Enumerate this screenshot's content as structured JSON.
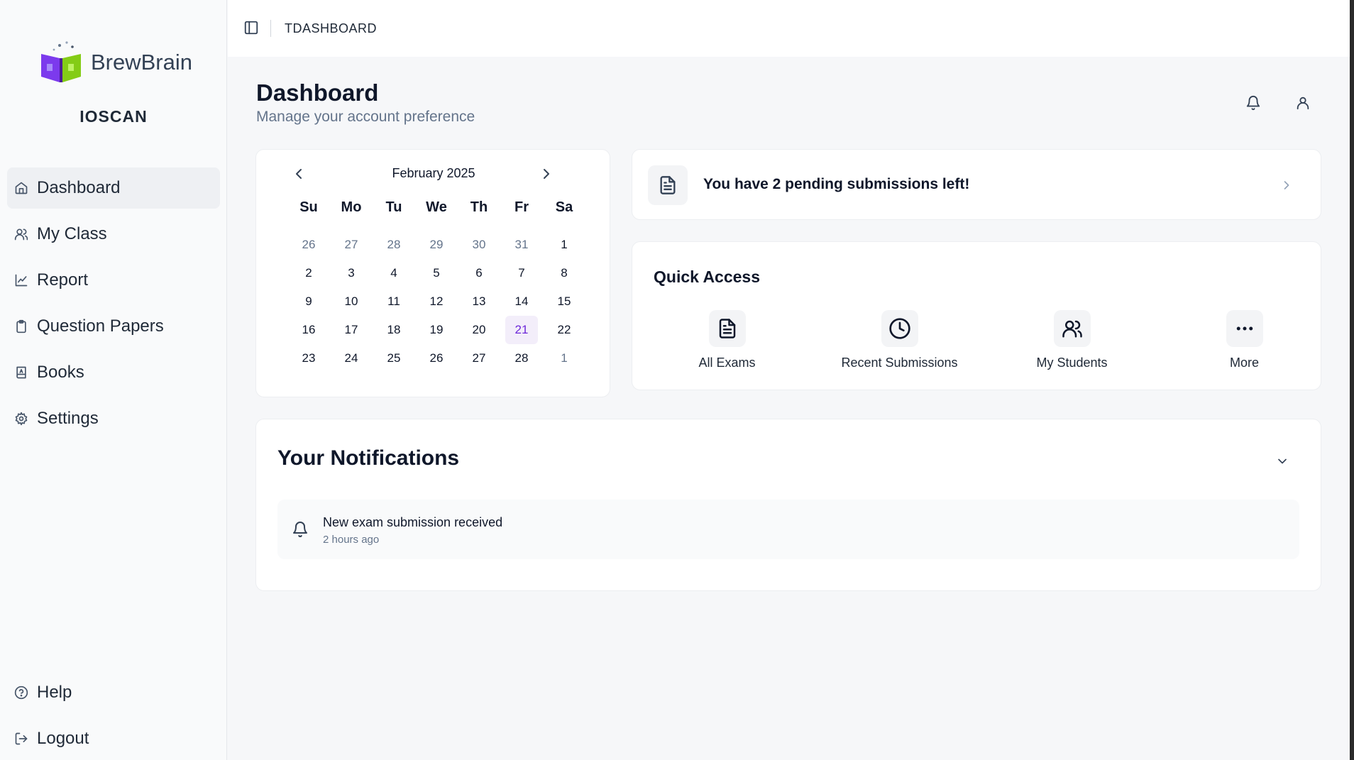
{
  "app": {
    "brand_name": "BrewBrain",
    "org_name": "IOSCAN"
  },
  "sidebar": {
    "items": [
      {
        "label": "Dashboard",
        "icon": "home-icon",
        "active": true
      },
      {
        "label": "My Class",
        "icon": "users-icon"
      },
      {
        "label": "Report",
        "icon": "chart-line-icon"
      },
      {
        "label": "Question Papers",
        "icon": "clipboard-icon"
      },
      {
        "label": "Books",
        "icon": "book-icon"
      },
      {
        "label": "Settings",
        "icon": "gear-icon"
      }
    ],
    "bottom_items": [
      {
        "label": "Help",
        "icon": "help-circle-icon"
      },
      {
        "label": "Logout",
        "icon": "logout-icon"
      }
    ]
  },
  "topbar": {
    "title": "TDASHBOARD"
  },
  "header": {
    "title": "Dashboard",
    "subtitle": "Manage your account preference"
  },
  "calendar": {
    "month_label": "February 2025",
    "weekdays": [
      "Su",
      "Mo",
      "Tu",
      "We",
      "Th",
      "Fr",
      "Sa"
    ],
    "days": [
      {
        "d": "26",
        "muted": true
      },
      {
        "d": "27",
        "muted": true
      },
      {
        "d": "28",
        "muted": true
      },
      {
        "d": "29",
        "muted": true
      },
      {
        "d": "30",
        "muted": true
      },
      {
        "d": "31",
        "muted": true
      },
      {
        "d": "1"
      },
      {
        "d": "2"
      },
      {
        "d": "3"
      },
      {
        "d": "4"
      },
      {
        "d": "5"
      },
      {
        "d": "6"
      },
      {
        "d": "7"
      },
      {
        "d": "8"
      },
      {
        "d": "9"
      },
      {
        "d": "10"
      },
      {
        "d": "11"
      },
      {
        "d": "12"
      },
      {
        "d": "13"
      },
      {
        "d": "14"
      },
      {
        "d": "15"
      },
      {
        "d": "16"
      },
      {
        "d": "17"
      },
      {
        "d": "18"
      },
      {
        "d": "19"
      },
      {
        "d": "20"
      },
      {
        "d": "21",
        "selected": true
      },
      {
        "d": "22"
      },
      {
        "d": "23"
      },
      {
        "d": "24"
      },
      {
        "d": "25"
      },
      {
        "d": "26"
      },
      {
        "d": "27"
      },
      {
        "d": "28"
      },
      {
        "d": "1",
        "muted": true
      }
    ]
  },
  "pending": {
    "text": "You have 2 pending submissions left!"
  },
  "quick_access": {
    "title": "Quick Access",
    "items": [
      {
        "label": "All Exams",
        "icon": "document-icon"
      },
      {
        "label": "Recent Submissions",
        "icon": "clock-icon"
      },
      {
        "label": "My Students",
        "icon": "users-icon"
      },
      {
        "label": "More",
        "icon": "more-horizontal-icon"
      }
    ]
  },
  "notifications": {
    "title": "Your Notifications",
    "items": [
      {
        "message": "New exam submission received",
        "time": "2 hours ago"
      }
    ]
  },
  "colors": {
    "accent": "#6d28d9",
    "selected_bg": "#f3eefa",
    "sidebar_active_bg": "#eef0f3",
    "page_bg": "#f6f7f9"
  }
}
